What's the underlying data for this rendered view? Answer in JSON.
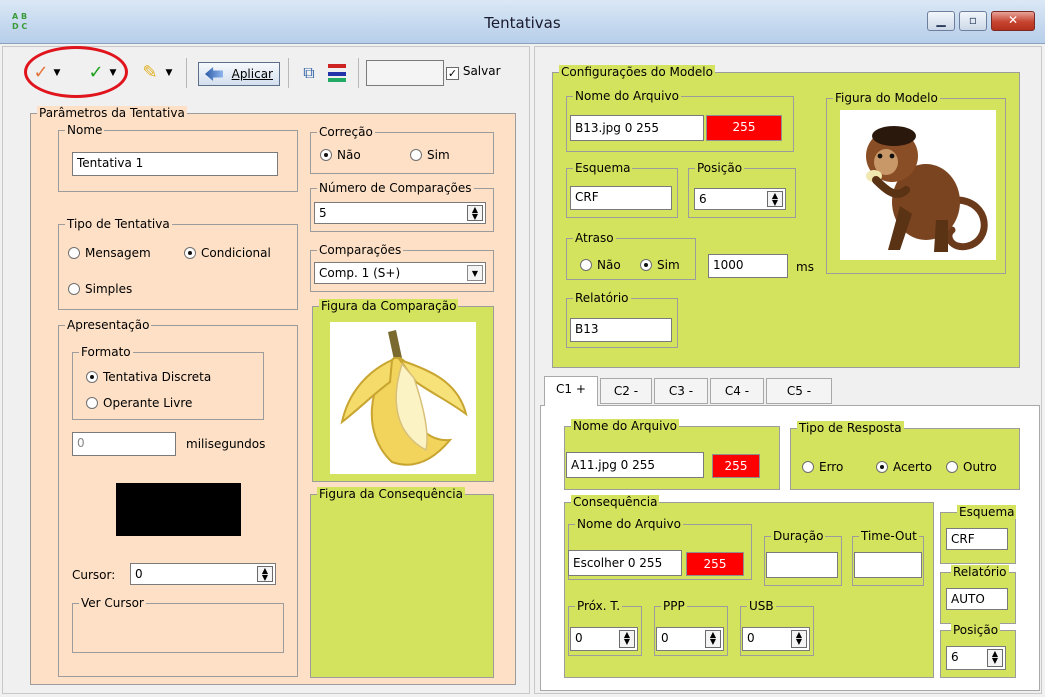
{
  "window": {
    "title": "Tentativas",
    "min_label": "▁",
    "max_label": "▫",
    "close_label": "✕"
  },
  "toolbar": {
    "apply_label": "Aplicar",
    "save_label": "Salvar",
    "save_checked": true,
    "text_value": ""
  },
  "params": {
    "legend": "Parâmetros da Tentativa",
    "name": {
      "legend": "Nome",
      "value": "Tentativa 1"
    },
    "correction": {
      "legend": "Correção",
      "options": [
        "Não",
        "Sim"
      ],
      "selected": "Não"
    },
    "num_comparisons": {
      "legend": "Número de Comparações",
      "value": "5"
    },
    "trial_type": {
      "legend": "Tipo de Tentativa",
      "options": [
        "Mensagem",
        "Condicional",
        "Simples"
      ],
      "selected": "Condicional"
    },
    "comparisons": {
      "legend": "Comparações",
      "value": "Comp. 1 (S+)"
    },
    "comparison_figure": {
      "legend": "Figura da Comparação"
    },
    "presentation": {
      "legend": "Apresentação",
      "format": {
        "legend": "Formato",
        "options": [
          "Tentativa Discreta",
          "Operante Livre"
        ],
        "selected": "Tentativa Discreta"
      },
      "ms_value": "0",
      "ms_label": "milisegundos",
      "cursor_label": "Cursor:",
      "cursor_value": "0",
      "view_cursor_legend": "Ver Cursor"
    },
    "consequence_figure": {
      "legend": "Figura da Consequência"
    }
  },
  "model": {
    "legend": "Configurações do Modelo",
    "file": {
      "legend": "Nome do Arquivo",
      "value": "B13.jpg 0 255",
      "color_value": "255"
    },
    "figure_legend": "Figura do Modelo",
    "scheme": {
      "legend": "Esquema",
      "value": "CRF"
    },
    "position": {
      "legend": "Posição",
      "value": "6"
    },
    "delay": {
      "legend": "Atraso",
      "options": [
        "Não",
        "Sim"
      ],
      "selected": "Sim",
      "value": "1000",
      "unit": "ms"
    },
    "report": {
      "legend": "Relatório",
      "value": "B13"
    }
  },
  "tabs": [
    {
      "label": "C1 +",
      "active": true
    },
    {
      "label": "C2 -",
      "active": false
    },
    {
      "label": "C3 -",
      "active": false
    },
    {
      "label": "C4 -",
      "active": false
    },
    {
      "label": "C5 -",
      "active": false
    }
  ],
  "comp": {
    "file": {
      "legend": "Nome do Arquivo",
      "value": "A11.jpg 0 255",
      "color_value": "255"
    },
    "response": {
      "legend": "Tipo de Resposta",
      "options": [
        "Erro",
        "Acerto",
        "Outro"
      ],
      "selected": "Acerto"
    },
    "consequence": {
      "legend": "Consequência",
      "file": {
        "legend": "Nome do Arquivo",
        "value": "Escolher 0 255",
        "color_value": "255"
      },
      "duration": {
        "legend": "Duração",
        "value": ""
      },
      "timeout": {
        "legend": "Time-Out",
        "value": ""
      },
      "next": {
        "legend": "Próx. T.",
        "value": "0"
      },
      "ppp": {
        "legend": "PPP",
        "value": "0"
      },
      "usb": {
        "legend": "USB",
        "value": "0"
      }
    },
    "scheme": {
      "legend": "Esquema",
      "value": "CRF"
    },
    "report": {
      "legend": "Relatório",
      "value": "AUTO"
    },
    "position": {
      "legend": "Posição",
      "value": "6"
    }
  },
  "colors": {
    "peach": "#fde0c6",
    "green": "#d4e35e",
    "red_field": "#ff0000",
    "highlight_circle": "#e0141c"
  }
}
